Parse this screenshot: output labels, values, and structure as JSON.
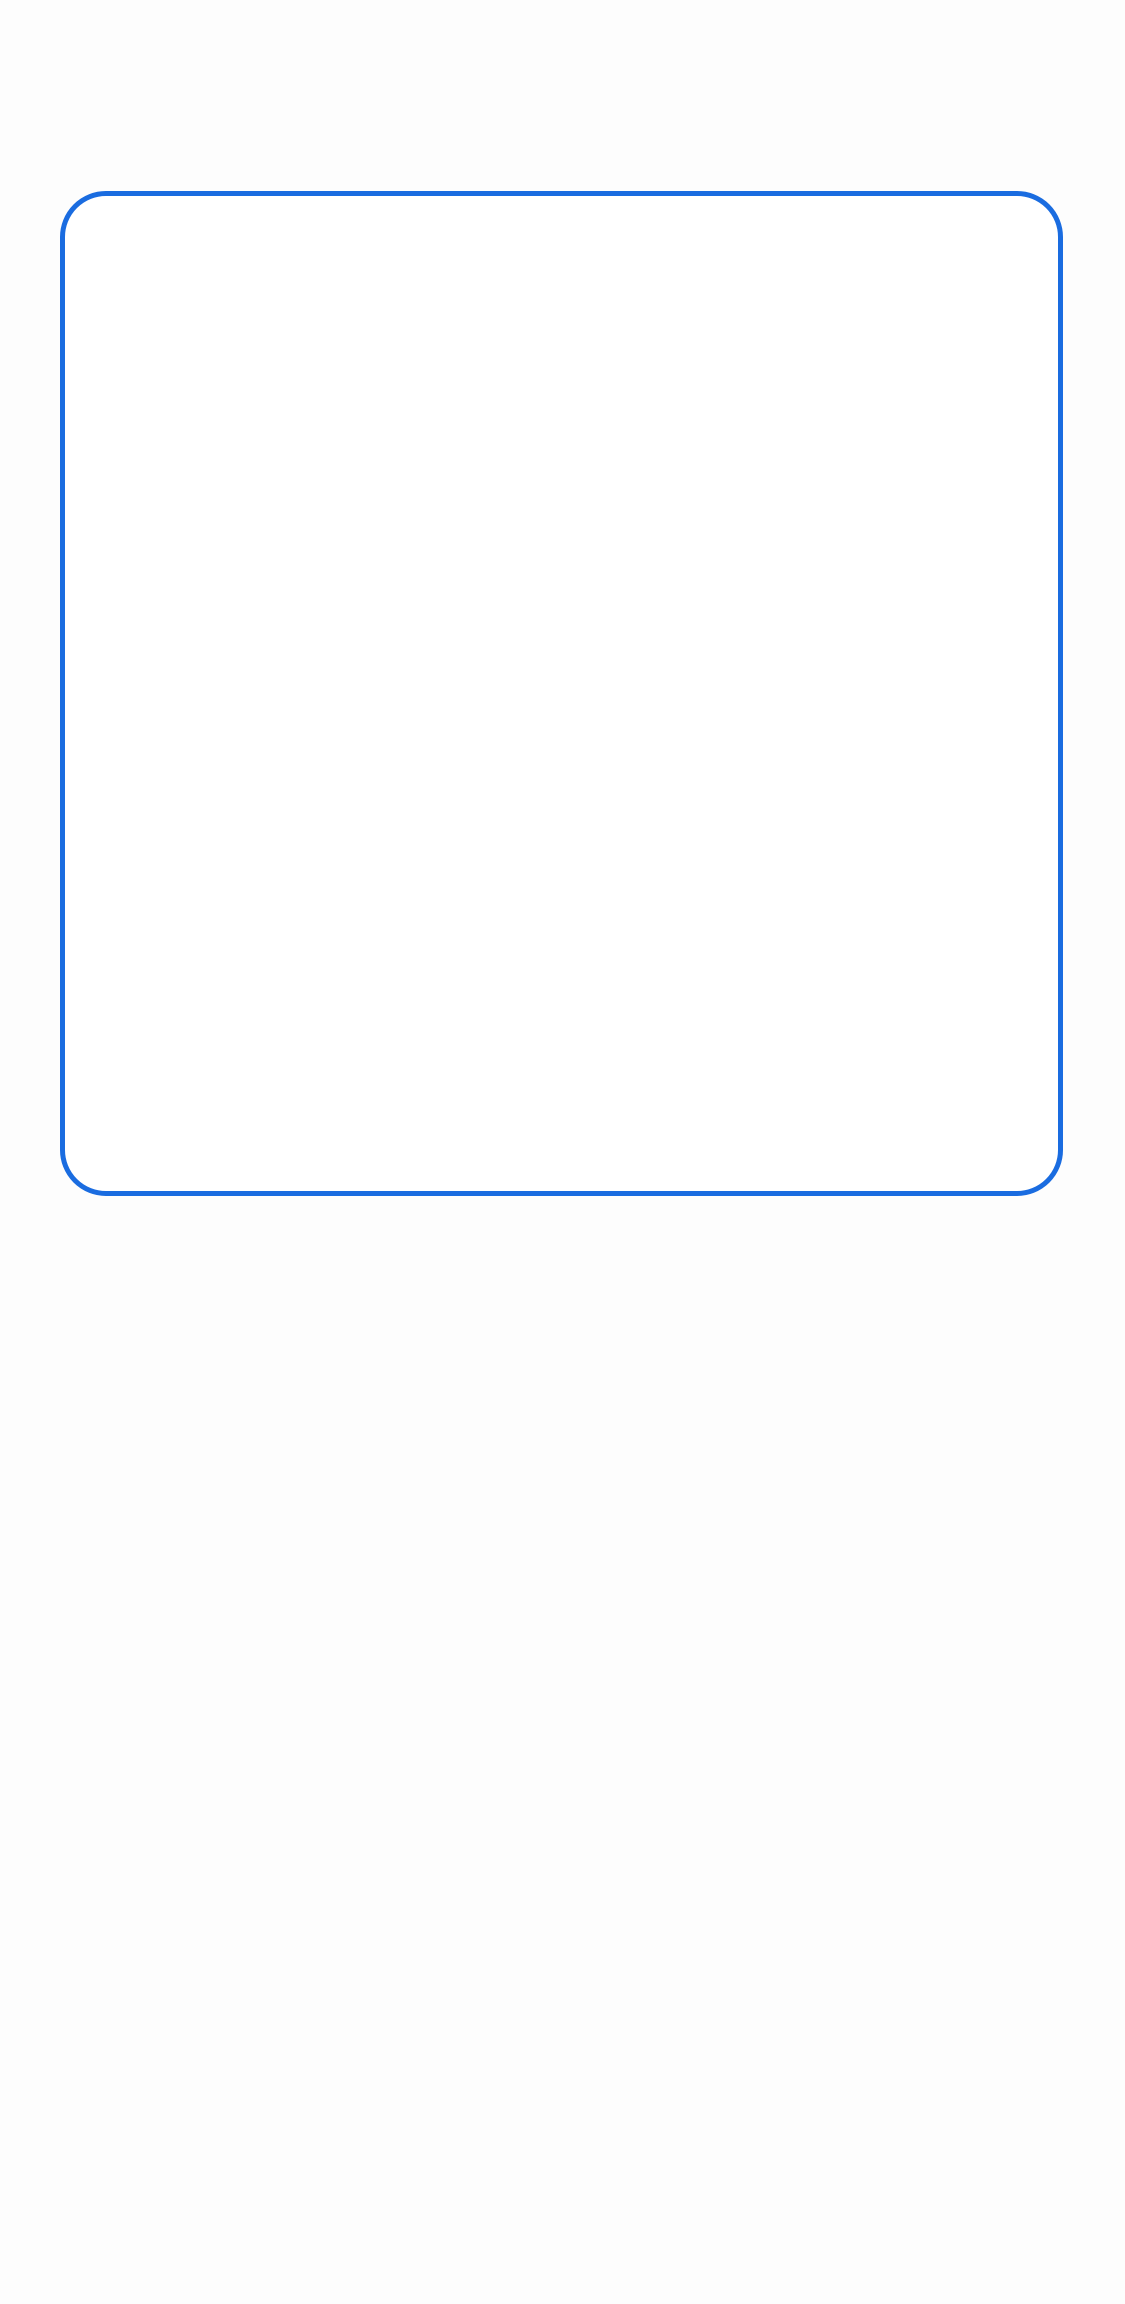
{
  "screen": {
    "background_color": "#fdfdfd"
  },
  "focused_frame": {
    "border_color": "#1a6ce0",
    "fill_color": "#ffffff"
  }
}
